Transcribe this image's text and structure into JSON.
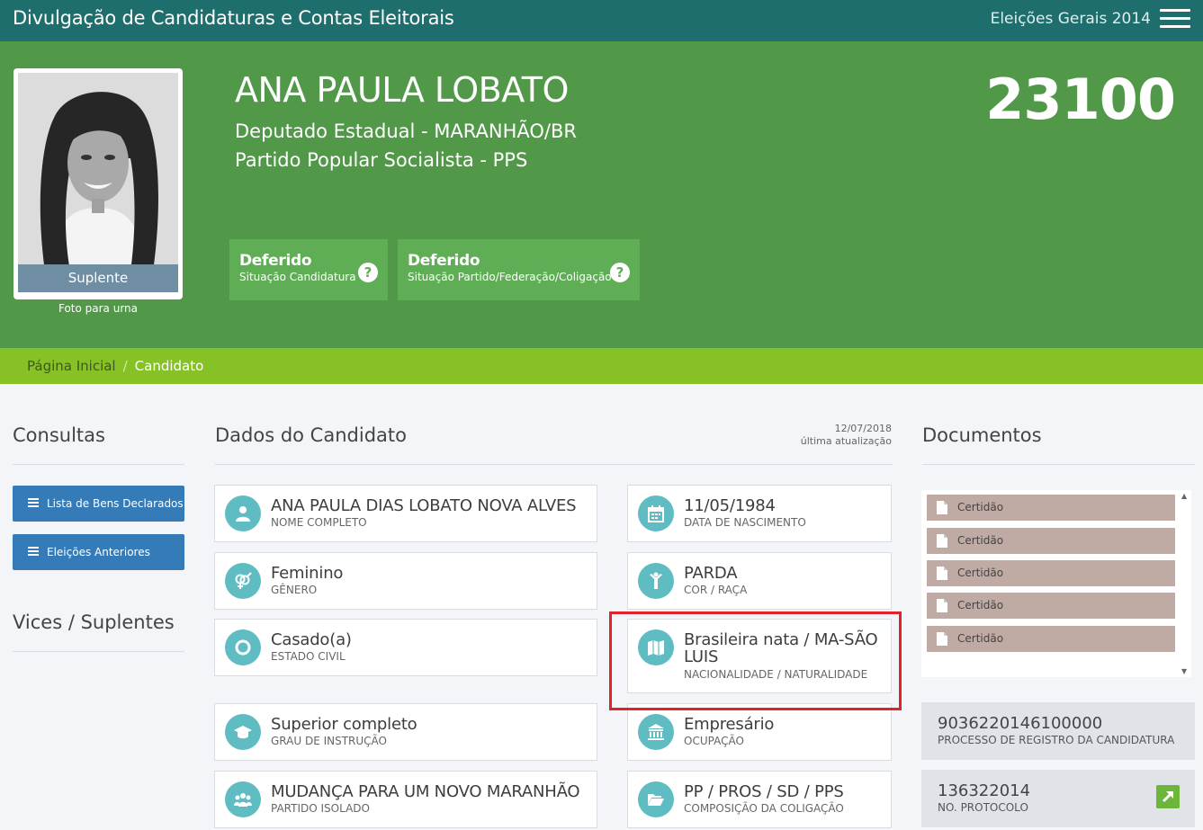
{
  "header": {
    "title": "Divulgação de Candidaturas e Contas Eleitorais",
    "election": "Eleições Gerais 2014"
  },
  "candidate": {
    "name": "ANA PAULA LOBATO",
    "office": "Deputado Estadual - MARANHÃO/BR",
    "party": "Partido Popular Socialista - PPS",
    "number": "23100",
    "photo_label": "Suplente",
    "photo_caption": "Foto para urna",
    "status": [
      {
        "main": "Deferido",
        "sub": "Situação Candidatura"
      },
      {
        "main": "Deferido",
        "sub": "Situação Partido/Federação/Coligação"
      }
    ]
  },
  "breadcrumb": {
    "home": "Página Inicial",
    "separator": "/",
    "current": "Candidato"
  },
  "left": {
    "consultas_title": "Consultas",
    "buttons": [
      "Lista de Bens Declarados",
      "Eleições Anteriores"
    ],
    "vices_title": "Vices / Suplentes"
  },
  "dados": {
    "title": "Dados do Candidato",
    "update_date": "12/07/2018",
    "update_label": "última atualização",
    "cards": [
      {
        "value": "ANA PAULA DIAS LOBATO NOVA ALVES",
        "label": "NOME COMPLETO",
        "icon": "user-icon"
      },
      {
        "value": "11/05/1984",
        "label": "DATA DE NASCIMENTO",
        "icon": "calendar-icon"
      },
      {
        "value": "Feminino",
        "label": "GÊNERO",
        "icon": "gender-icon"
      },
      {
        "value": "PARDA",
        "label": "COR / RAÇA",
        "icon": "person-arms-up-icon"
      },
      {
        "value": "Casado(a)",
        "label": "ESTADO CIVIL",
        "icon": "ring-icon"
      },
      {
        "value": "Brasileira nata / MA-SÃO LUIS",
        "label": "NACIONALIDADE / NATURALIDADE",
        "icon": "map-icon"
      },
      {
        "value": "Superior completo",
        "label": "GRAU DE INSTRUÇÃO",
        "icon": "graduation-cap-icon"
      },
      {
        "value": "Empresário",
        "label": "OCUPAÇÃO",
        "icon": "bank-icon"
      },
      {
        "value": "MUDANÇA PARA UM NOVO MARANHÃO",
        "label": "PARTIDO ISOLADO",
        "icon": "group-icon"
      },
      {
        "value": "PP / PROS / SD / PPS",
        "label": "COMPOSIÇÃO DA COLIGAÇÃO",
        "icon": "folder-open-icon"
      }
    ]
  },
  "documentos": {
    "title": "Documentos",
    "items": [
      "Certidão",
      "Certidão",
      "Certidão",
      "Certidão",
      "Certidão"
    ],
    "processo": {
      "value": "9036220146100000",
      "label": "PROCESSO DE REGISTRO DA CANDIDATURA"
    },
    "protocolo": {
      "value": "136322014",
      "label": "NO. PROTOCOLO"
    }
  },
  "colors": {
    "topbar": "#1f6e6e",
    "hero": "#519948",
    "breadcrumb": "#86c226",
    "button": "#347bb8",
    "icon_circle": "#5fbcc2",
    "highlight": "#e0232b"
  }
}
